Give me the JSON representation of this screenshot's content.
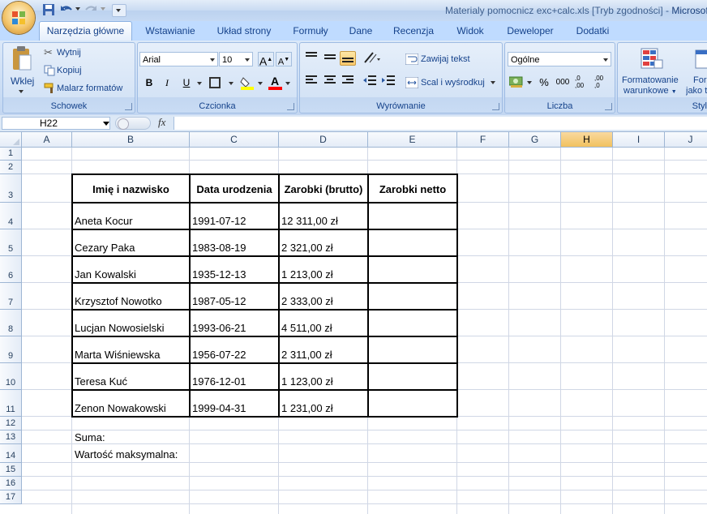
{
  "window": {
    "title": "Materialy pomocnicz exc+calc.xls  [Tryb zgodności] - ",
    "app": "Microsoft E"
  },
  "tabs": [
    "Narzędzia główne",
    "Wstawianie",
    "Układ strony",
    "Formuły",
    "Dane",
    "Recenzja",
    "Widok",
    "Deweloper",
    "Dodatki"
  ],
  "ribbon": {
    "clipboard": {
      "label": "Schowek",
      "paste": "Wklej",
      "cut": "Wytnij",
      "copy": "Kopiuj",
      "painter": "Malarz formatów"
    },
    "font": {
      "label": "Czcionka",
      "font_name": "Arial",
      "font_size": "10",
      "bold": "B",
      "italic": "I",
      "underline": "U",
      "grow": "A",
      "shrink": "A",
      "fill_letter": "A"
    },
    "alignment": {
      "label": "Wyrównanie",
      "wrap": "Zawijaj tekst",
      "merge": "Scal i wyśrodkuj"
    },
    "number": {
      "label": "Liczba",
      "format": "Ogólne",
      "percent": "%",
      "thousands": "000",
      "inc_dec": ",0\n,00",
      "dec_dec": ",00\n,0"
    },
    "styles": {
      "label": "Styl",
      "cond_format_1": "Formatowanie",
      "cond_format_2": "warunkowe",
      "table_1": "For",
      "table_2": "jako t"
    }
  },
  "formula_bar": {
    "name_box": "H22",
    "fx": "fx",
    "content": ""
  },
  "columns": [
    "A",
    "B",
    "C",
    "D",
    "E",
    "F",
    "G",
    "H",
    "I",
    "J"
  ],
  "selected_column": "H",
  "rows": [
    "1",
    "2",
    "3",
    "4",
    "5",
    "6",
    "7",
    "8",
    "9",
    "10",
    "11",
    "12",
    "13",
    "14",
    "15",
    "16",
    "17"
  ],
  "table": {
    "headers": [
      "Imię i nazwisko",
      "Data urodzenia",
      "Zarobki (brutto)",
      "Zarobki netto"
    ],
    "rows": [
      [
        "Aneta Kocur",
        "1991-07-12",
        "12 311,00 zł",
        ""
      ],
      [
        "Cezary Paka",
        "1983-08-19",
        "2 321,00 zł",
        ""
      ],
      [
        "Jan Kowalski",
        "1935-12-13",
        "1 213,00 zł",
        ""
      ],
      [
        "Krzysztof Nowotko",
        "1987-05-12",
        "2 333,00 zł",
        ""
      ],
      [
        "Lucjan Nowosielski",
        "1993-06-21",
        "4 511,00 zł",
        ""
      ],
      [
        "Marta Wiśniewska",
        "1956-07-22",
        "2 311,00 zł",
        ""
      ],
      [
        "Teresa Kuć",
        "1976-12-01",
        "1 123,00 zł",
        ""
      ],
      [
        "Zenon Nowakowski",
        "1999-04-31",
        "1 231,00 zł",
        ""
      ]
    ]
  },
  "summary": {
    "sum_label": "Suma:",
    "max_label": "Wartość maksymalna:"
  }
}
